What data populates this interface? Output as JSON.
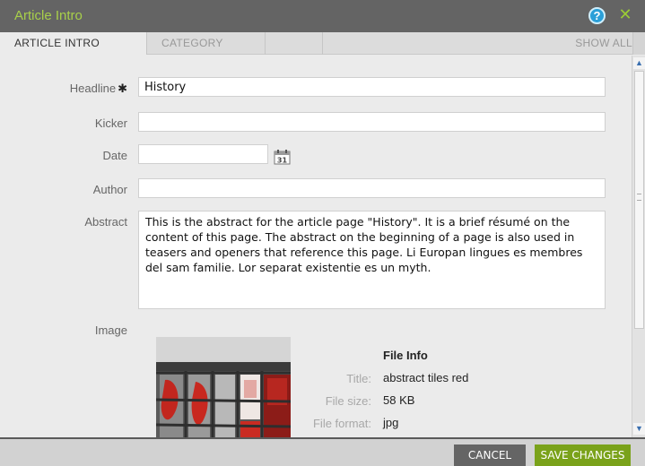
{
  "dialog": {
    "title": "Article Intro"
  },
  "tabs": [
    {
      "label": "ARTICLE INTRO"
    },
    {
      "label": "CATEGORY"
    },
    {
      "label": ""
    },
    {
      "label": "SHOW ALL"
    }
  ],
  "form": {
    "headline": {
      "label": "Headline",
      "required_mark": "✱",
      "value": "History"
    },
    "kicker": {
      "label": "Kicker",
      "value": ""
    },
    "date": {
      "label": "Date",
      "value": "",
      "calendar_icon_text": "31"
    },
    "author": {
      "label": "Author",
      "value": ""
    },
    "abstract": {
      "label": "Abstract",
      "value": "This is the abstract for the article page \"History\". It is a brief résumé on the content of this page. The abstract on the beginning of a page is also used in teasers and openers that reference this page. Li Europan lingues es membres del sam familie. Lor separat existentie es un myth."
    },
    "image": {
      "label": "Image"
    }
  },
  "file_info": {
    "heading": "File Info",
    "rows": [
      {
        "label": "Title:",
        "value": "abstract tiles red"
      },
      {
        "label": "File size:",
        "value": "58 KB"
      },
      {
        "label": "File format:",
        "value": "jpg"
      }
    ]
  },
  "footer": {
    "cancel_label": "CANCEL",
    "save_label": "SAVE CHANGES"
  },
  "colors": {
    "title_green": "#a8d04a",
    "save_green": "#7aa21a",
    "help_blue": "#2a9fd8"
  },
  "icons": {
    "help": "help-icon",
    "close": "close-icon",
    "calendar": "calendar-icon"
  }
}
